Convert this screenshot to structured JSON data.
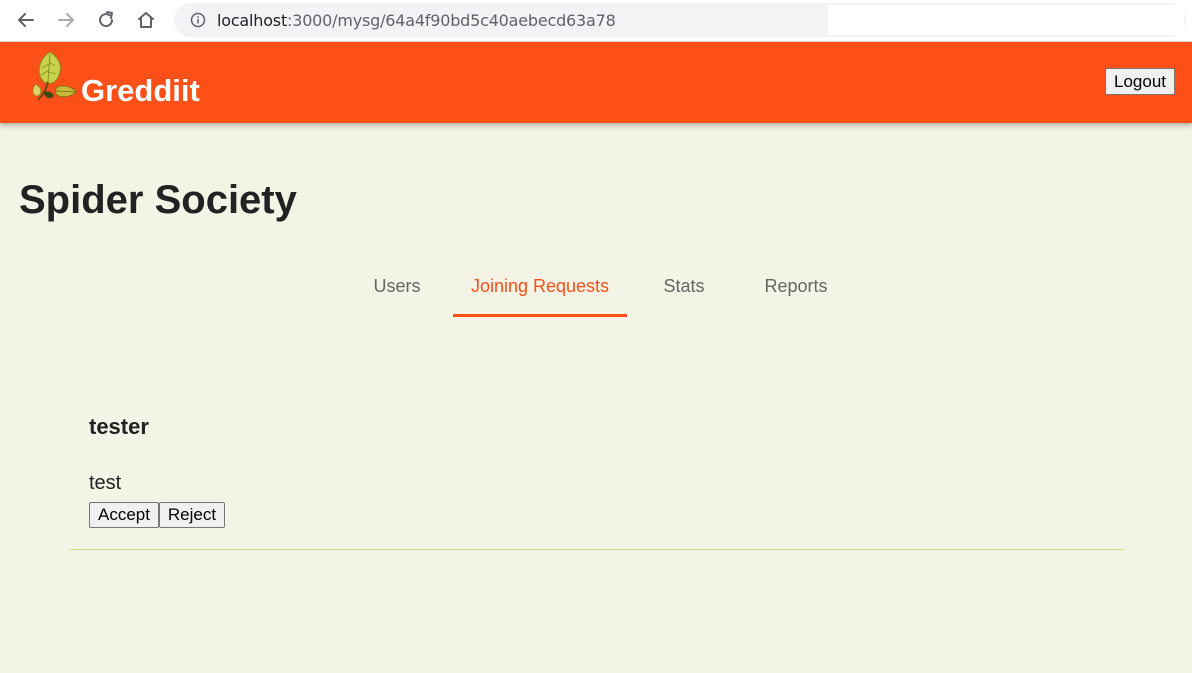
{
  "browser": {
    "url_host": "localhost",
    "url_rest": ":3000/mysg/64a4f90bd5c40aebecd63a78",
    "icons": {
      "back": "arrow-left-icon",
      "forward": "arrow-right-icon",
      "reload": "reload-icon",
      "home": "home-icon",
      "info": "info-icon"
    }
  },
  "header": {
    "app_name": "Greddiit",
    "logout_label": "Logout",
    "background_color": "#fd4f18",
    "logo_icon": "leaf-logo-icon"
  },
  "page": {
    "title": "Spider Society"
  },
  "tabs": [
    {
      "label": "Users",
      "active": false
    },
    {
      "label": "Joining Requests",
      "active": true
    },
    {
      "label": "Stats",
      "active": false
    },
    {
      "label": "Reports",
      "active": false
    }
  ],
  "requests": [
    {
      "username": "tester",
      "message": "test",
      "accept_label": "Accept",
      "reject_label": "Reject"
    }
  ],
  "colors": {
    "accent": "#fd4f18",
    "page_background": "#f3f3e6",
    "divider": "#cfe07a"
  }
}
